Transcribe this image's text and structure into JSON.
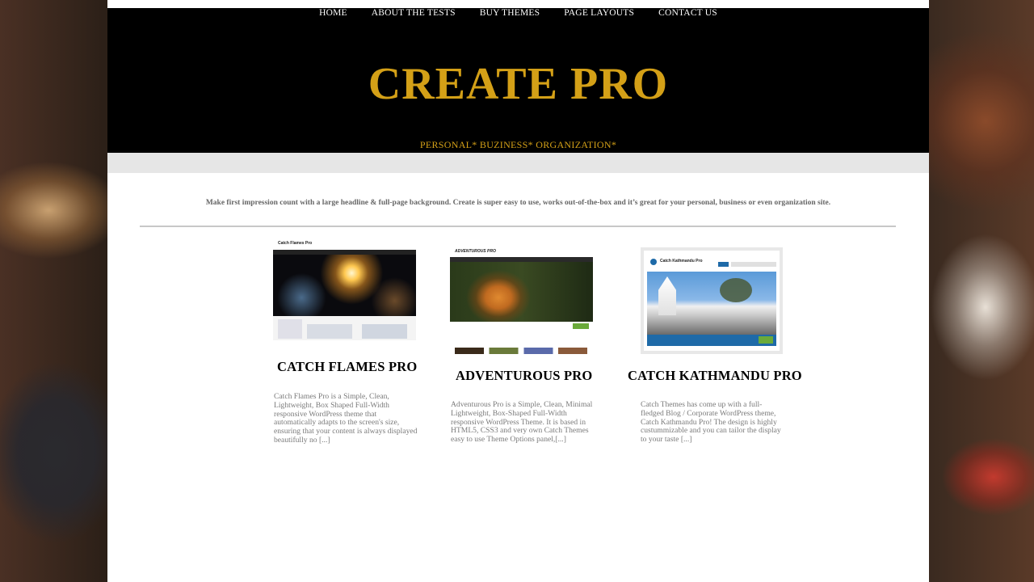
{
  "nav": {
    "items": [
      "HOME",
      "ABOUT THE TESTS",
      "BUY THEMES",
      "PAGE LAYOUTS",
      "CONTACT US"
    ]
  },
  "header": {
    "title": "CREATE PRO",
    "tagline": "PERSONAL* BUZINESS* ORGANIZATION*"
  },
  "intro": "Make first impression count with a large headline & full-page background. Create is super easy to use, works out-of-the-box and it’s great for your personal, business or even organization site.",
  "cards": [
    {
      "title": "CATCH FLAMES PRO",
      "thumb_label": "Catch Flames Pro",
      "description": "Catch Flames Pro is a Simple, Clean, Lightweight, Box Shaped Full-Width responsive WordPress theme that automatically adapts to the screen's size, ensuring that your content is always displayed beautifully no [...]"
    },
    {
      "title": "ADVENTUROUS PRO",
      "thumb_label": "ADVENTUROUS PRO",
      "description": "Adventurous Pro is a Simple, Clean, Minimal Lightweight, Box-Shaped Full-Width responsive WordPress Theme. It is based in HTML5, CSS3 and very own Catch Themes easy to use Theme Options panel,[...]"
    },
    {
      "title": "CATCH KATHMANDU PRO",
      "thumb_label": "Catch Kathmandu Pro",
      "description": "Catch Themes has come up with a full-fledged Blog / Corporate WordPress theme, Catch Kathmandu Pro! The design is highly custummizable and you can tailor the display to your taste [...]"
    }
  ],
  "colors": {
    "accent_gold": "#d4a017",
    "header_bg": "#000000",
    "band_gray": "#e6e6e6"
  }
}
